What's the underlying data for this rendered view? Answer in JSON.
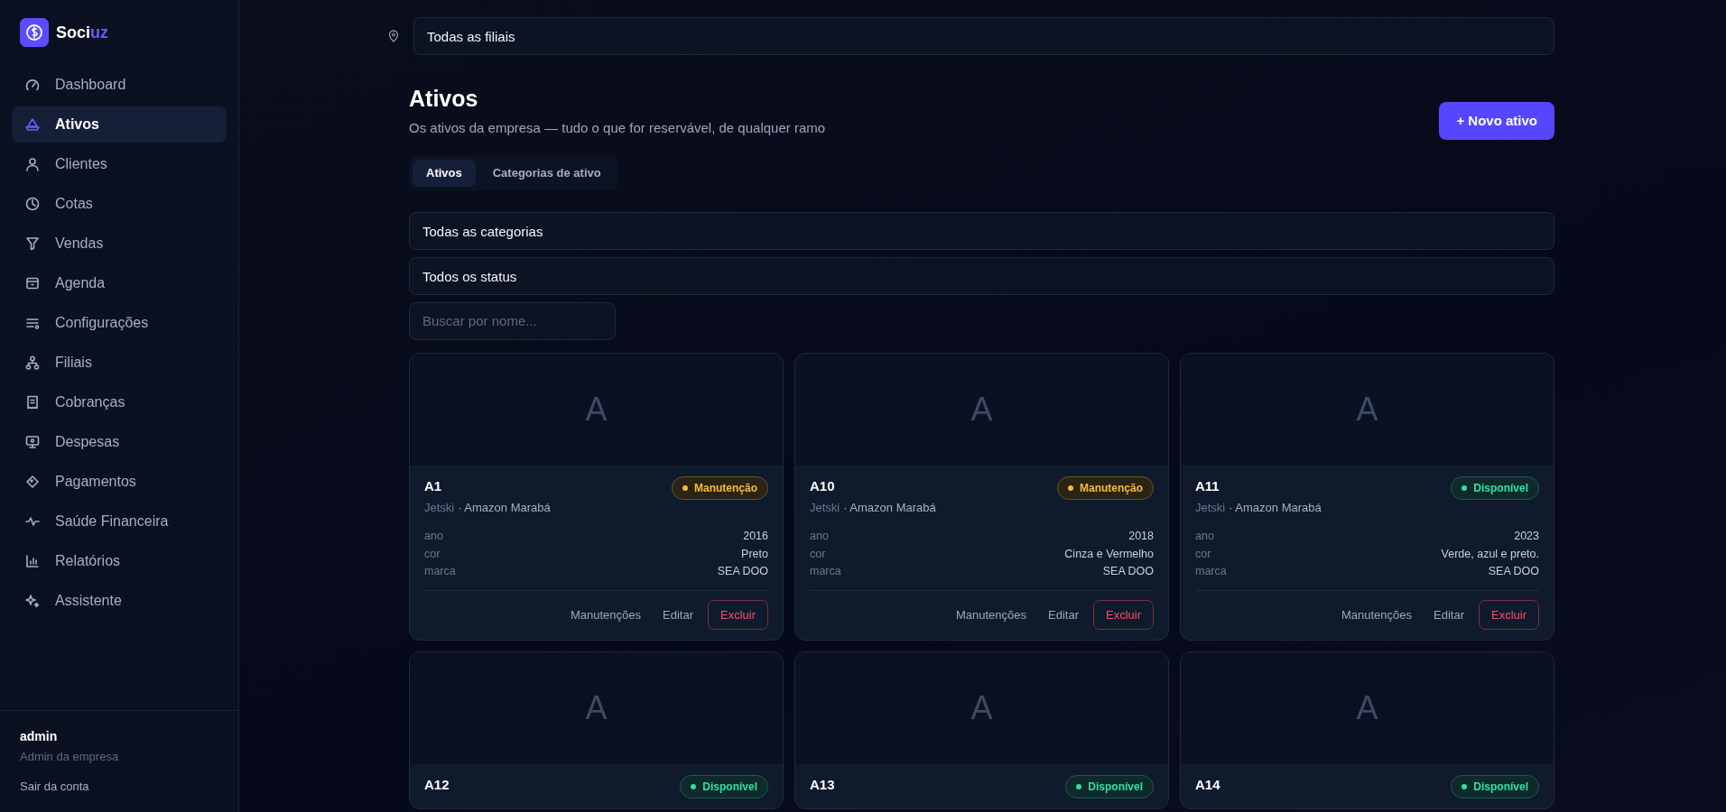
{
  "brand": {
    "name_start": "Soci",
    "name_end": "uz"
  },
  "sidebar": {
    "items": [
      {
        "label": "Dashboard",
        "selected": false
      },
      {
        "label": "Ativos",
        "selected": true
      },
      {
        "label": "Clientes",
        "selected": false
      },
      {
        "label": "Cotas",
        "selected": false
      },
      {
        "label": "Vendas",
        "selected": false
      },
      {
        "label": "Agenda",
        "selected": false
      },
      {
        "label": "Configurações",
        "selected": false
      },
      {
        "label": "Filiais",
        "selected": false
      },
      {
        "label": "Cobranças",
        "selected": false
      },
      {
        "label": "Despesas",
        "selected": false
      },
      {
        "label": "Pagamentos",
        "selected": false
      },
      {
        "label": "Saúde Financeira",
        "selected": false
      },
      {
        "label": "Relatórios",
        "selected": false
      },
      {
        "label": "Assistente",
        "selected": false
      }
    ],
    "user": {
      "name": "admin",
      "role": "Admin da empresa",
      "logout": "Sair da conta"
    }
  },
  "branch_select": {
    "value": "Todas as filiais"
  },
  "header": {
    "title": "Ativos",
    "subtitle": "Os ativos da empresa — tudo o que for reservável, de qualquer ramo",
    "new_button": "+ Novo ativo"
  },
  "tabs": [
    {
      "label": "Ativos",
      "selected": true
    },
    {
      "label": "Categorias de ativo",
      "selected": false
    }
  ],
  "filters": {
    "category": "Todas as categorias",
    "status": "Todos os status",
    "search": {
      "placeholder": "Buscar por nome..."
    }
  },
  "assets": [
    {
      "initial": "A",
      "name": "A1",
      "category": "Jetski",
      "branch": "· Amazon Marabá",
      "status": {
        "label": "Manutenção",
        "kind": "maintenance"
      },
      "attributes": [
        {
          "key": "ano",
          "value": "2016"
        },
        {
          "key": "cor",
          "value": "Preto"
        },
        {
          "key": "marca",
          "value": "SEA DOO"
        }
      ],
      "actions": {
        "maintenance": "Manutenções",
        "edit": "Editar",
        "delete": "Excluir"
      }
    },
    {
      "initial": "A",
      "name": "A10",
      "category": "Jetski",
      "branch": "· Amazon Marabá",
      "status": {
        "label": "Manutenção",
        "kind": "maintenance"
      },
      "attributes": [
        {
          "key": "ano",
          "value": "2018"
        },
        {
          "key": "cor",
          "value": "Cinza e Vermelho"
        },
        {
          "key": "marca",
          "value": "SEA DOO"
        }
      ],
      "actions": {
        "maintenance": "Manutenções",
        "edit": "Editar",
        "delete": "Excluir"
      }
    },
    {
      "initial": "A",
      "name": "A11",
      "category": "Jetski",
      "branch": "· Amazon Marabá",
      "status": {
        "label": "Disponível",
        "kind": "available"
      },
      "attributes": [
        {
          "key": "ano",
          "value": "2023"
        },
        {
          "key": "cor",
          "value": "Verde, azul e preto."
        },
        {
          "key": "marca",
          "value": "SEA DOO"
        }
      ],
      "actions": {
        "maintenance": "Manutenções",
        "edit": "Editar",
        "delete": "Excluir"
      }
    },
    {
      "initial": "A",
      "name": "A12",
      "status": {
        "label": "Disponível",
        "kind": "available"
      }
    },
    {
      "initial": "A",
      "name": "A13",
      "status": {
        "label": "Disponível",
        "kind": "available"
      }
    },
    {
      "initial": "A",
      "name": "A14",
      "status": {
        "label": "Disponível",
        "kind": "available"
      }
    }
  ]
}
